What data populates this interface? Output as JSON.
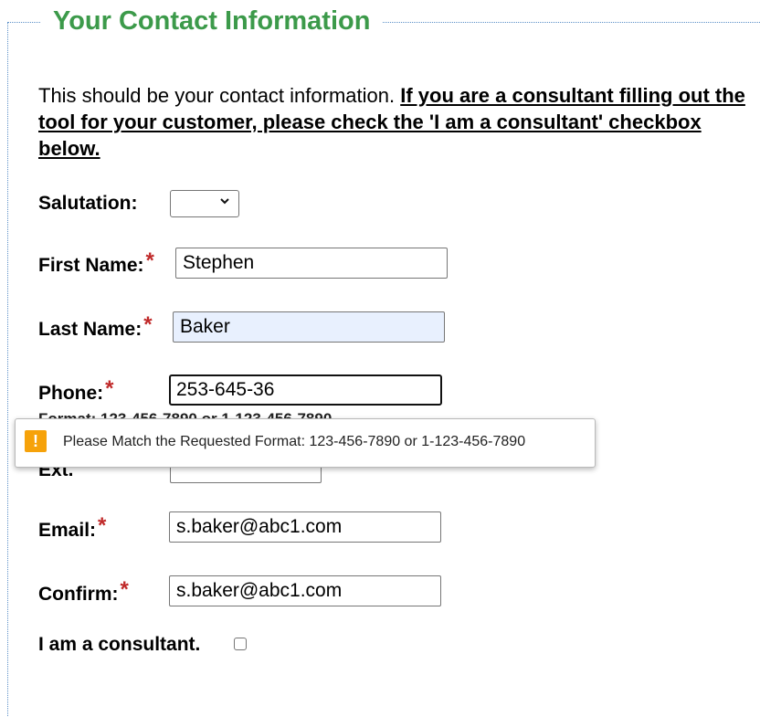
{
  "legend": "Your Contact Information",
  "intro": {
    "plain": "This should be your contact information. ",
    "emphasis": "If you are a consultant filling out the tool for your customer, please check the 'I am a consultant' checkbox below."
  },
  "fields": {
    "salutation": {
      "label": "Salutation:",
      "value": ""
    },
    "first_name": {
      "label": "First Name:",
      "value": "Stephen"
    },
    "last_name": {
      "label": "Last Name:",
      "value": "Baker"
    },
    "phone": {
      "label": "Phone:",
      "value": "253-645-36",
      "hint": "Format: 123-456-7890 or 1-123-456-7890"
    },
    "ext": {
      "label": "Ext.",
      "value": ""
    },
    "email": {
      "label": "Email:",
      "value": "s.baker@abc1.com"
    },
    "confirm": {
      "label": "Confirm:",
      "value": "s.baker@abc1.com"
    },
    "consultant": {
      "label": "I am a consultant.",
      "checked": false
    }
  },
  "required_marker": "*",
  "tooltip": {
    "icon": "!",
    "message": "Please Match the Requested Format: 123-456-7890 or 1-123-456-7890"
  },
  "colors": {
    "legend": "#3c9a4a",
    "required": "#c02a2a",
    "warning": "#f6a20a",
    "autofill": "#e8f0fe"
  },
  "icons": {
    "select_chevron": "chevron-down-icon",
    "warning": "warning-icon"
  }
}
